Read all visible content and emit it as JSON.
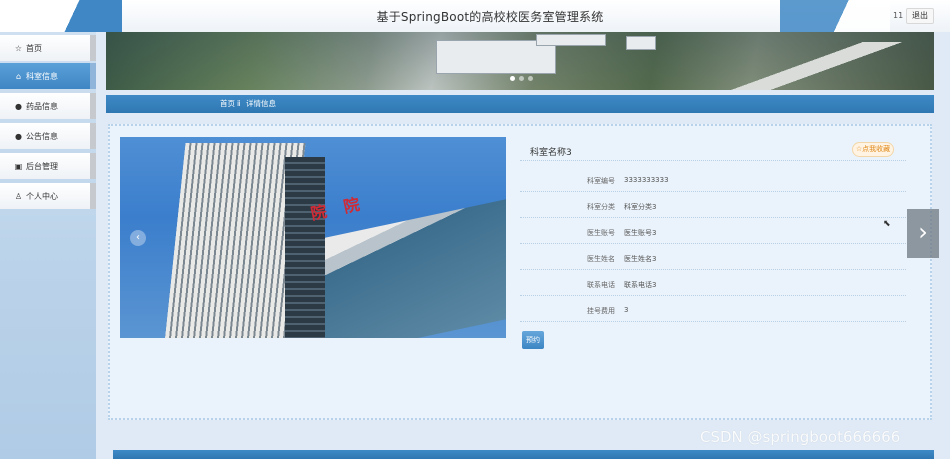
{
  "header": {
    "title": "基于SpringBoot的高校校医务室管理系统",
    "user": "11",
    "logout_label": "退出"
  },
  "sidebar": {
    "items": [
      {
        "label": "首页",
        "icon": "star-icon",
        "active": false
      },
      {
        "label": "科室信息",
        "icon": "home-icon",
        "active": true
      },
      {
        "label": "药品信息",
        "icon": "info-circle-icon",
        "active": false
      },
      {
        "label": "公告信息",
        "icon": "help-circle-icon",
        "active": false
      },
      {
        "label": "后台管理",
        "icon": "calendar-icon",
        "active": false
      },
      {
        "label": "个人中心",
        "icon": "user-icon",
        "active": false
      }
    ]
  },
  "breadcrumb": {
    "home": "首页",
    "separator": "ⅱ",
    "current": "详情信息"
  },
  "detail": {
    "name": "科室名称3",
    "favorite_label": "☆点我收藏",
    "fields": [
      {
        "label": "科室编号",
        "value": "3333333333"
      },
      {
        "label": "科室分类",
        "value": "科室分类3"
      },
      {
        "label": "医生账号",
        "value": "医生账号3"
      },
      {
        "label": "医生姓名",
        "value": "医生姓名3"
      },
      {
        "label": "联系电话",
        "value": "联系电话3"
      },
      {
        "label": "挂号费用",
        "value": "3"
      }
    ],
    "book_label": "预约"
  },
  "watermark": "CSDN @springboot666666",
  "colors": {
    "primary": "#3e8ac6",
    "favorite": "#e08a1a"
  }
}
